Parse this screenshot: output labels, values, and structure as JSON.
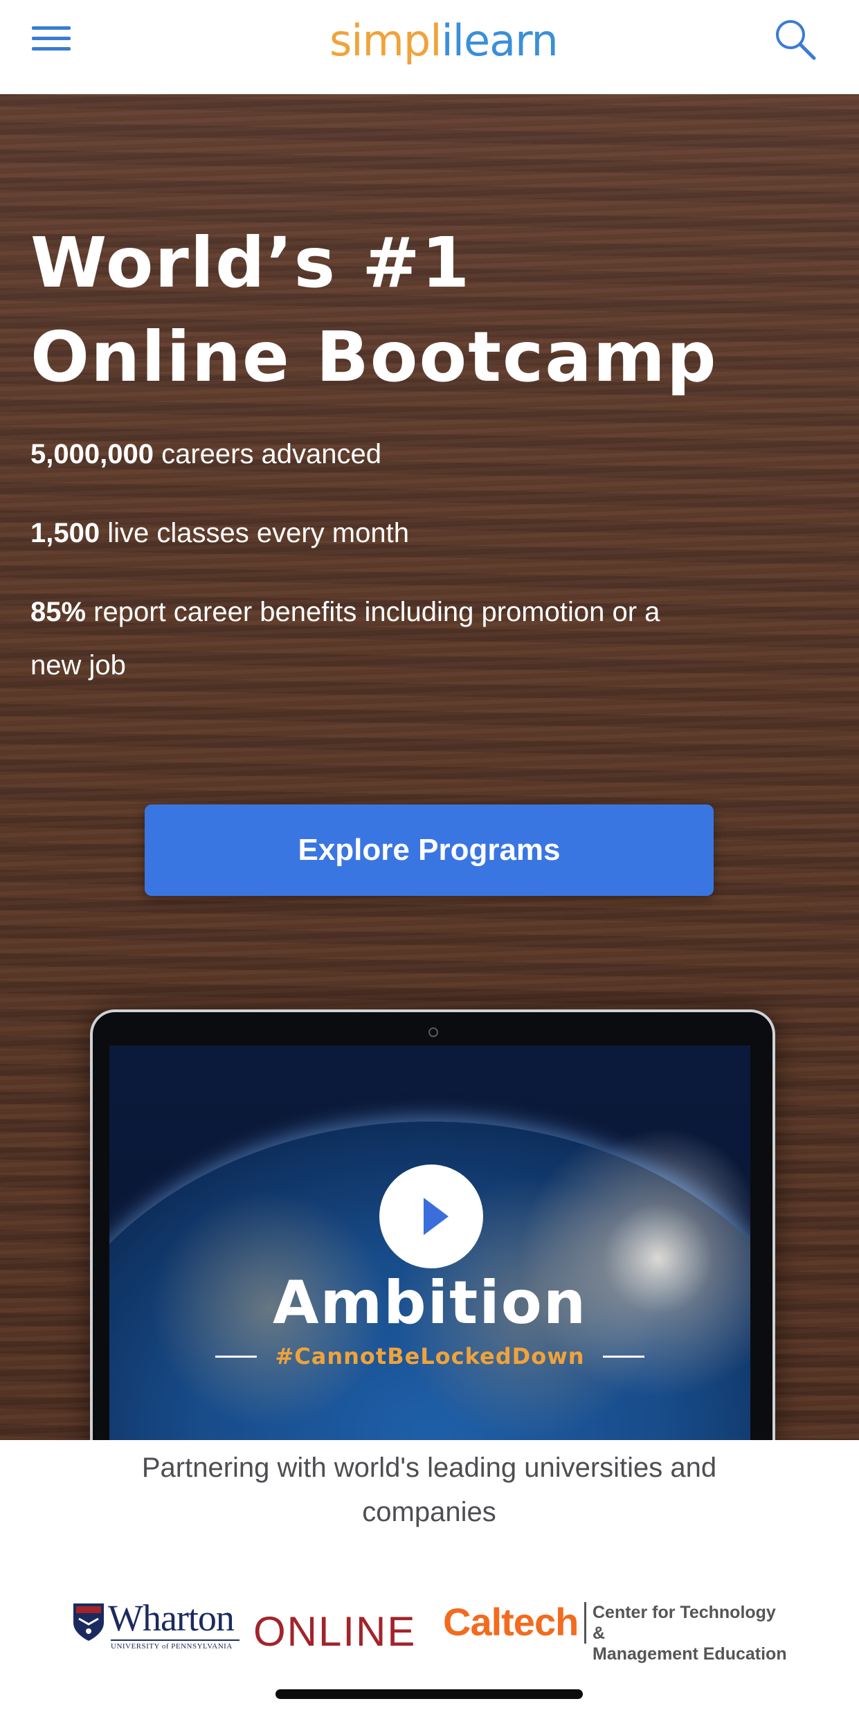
{
  "header": {
    "logo_part1": "simpl",
    "logo_part2": "ilearn"
  },
  "hero": {
    "title_line1": "World’s #1",
    "title_line2": "Online Bootcamp",
    "stats": [
      {
        "value": "5,000,000",
        "text": " careers advanced"
      },
      {
        "value": "1,500",
        "text": " live classes every month"
      },
      {
        "value": "85%",
        "text": " report career benefits including promotion or a new job"
      }
    ],
    "cta_label": "Explore Programs"
  },
  "video": {
    "title": "Ambition",
    "tagline": "#CannotBeLockedDown"
  },
  "partners": {
    "heading": "Partnering with world's leading universities and companies",
    "wharton_name": "Wharton",
    "wharton_subtitle": "UNIVERSITY of PENNSYLVANIA",
    "wharton_online": "ONLINE",
    "caltech_name": "Caltech",
    "caltech_line1": "Center for Technology &",
    "caltech_line2": "Management Education"
  },
  "colors": {
    "brand_blue": "#3a76e2",
    "brand_orange": "#f0a33a"
  }
}
